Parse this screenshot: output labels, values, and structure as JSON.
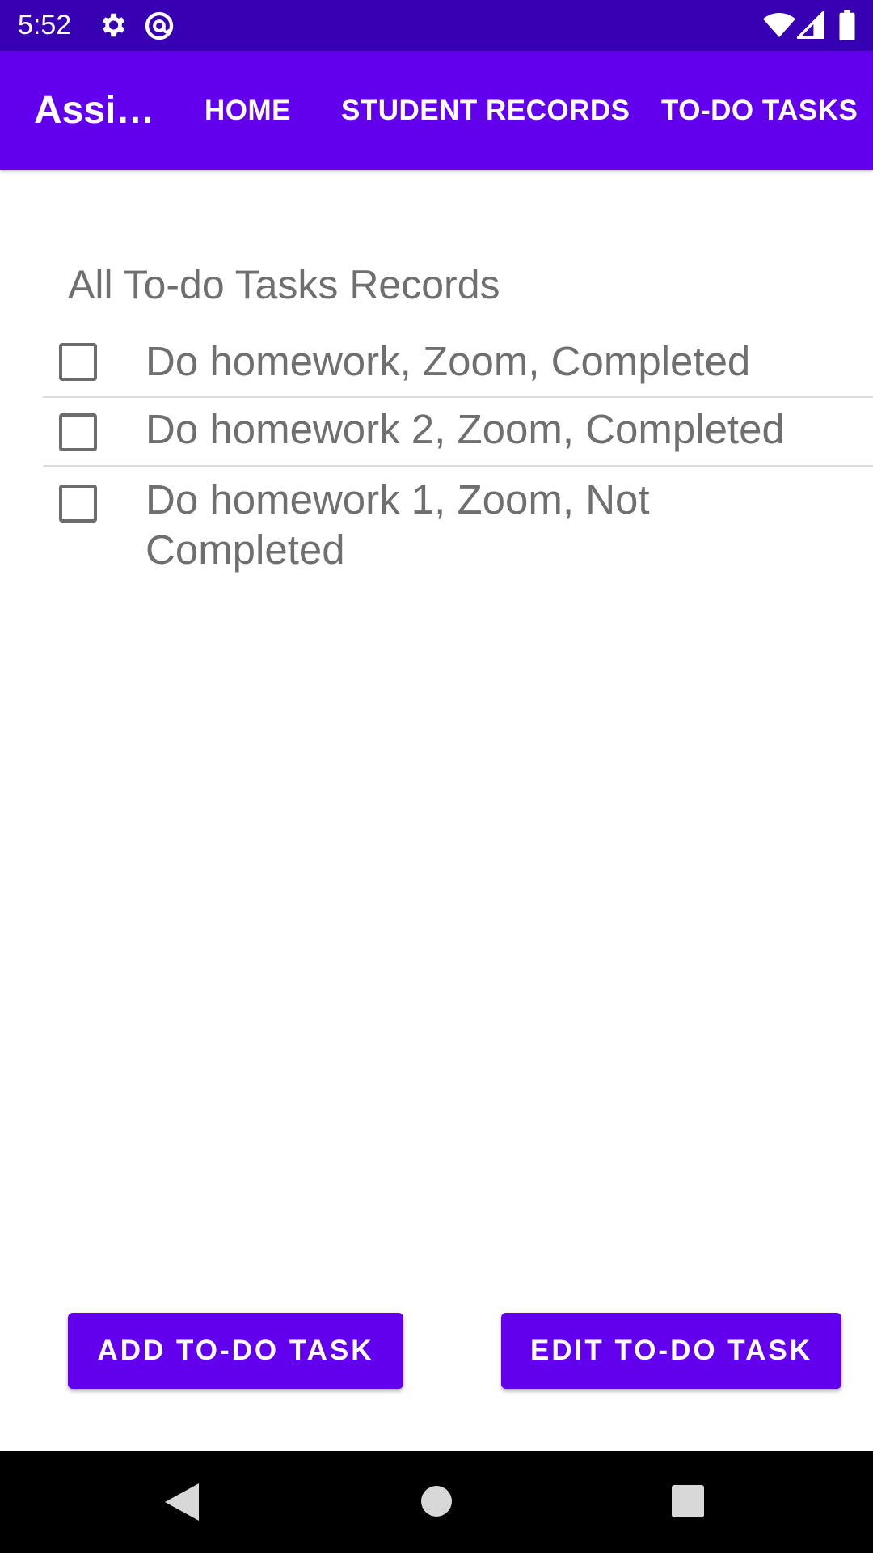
{
  "status_bar": {
    "time": "5:52",
    "icons": [
      "settings-icon",
      "at-sign-icon",
      "wifi-icon",
      "signal-icon",
      "battery-icon"
    ]
  },
  "app_bar": {
    "title": "Assi…",
    "menu": [
      "HOME",
      "STUDENT RECORDS",
      "TO-DO TASKS"
    ]
  },
  "content": {
    "section_title": "All To-do Tasks Records",
    "tasks": [
      {
        "label": "Do homework, Zoom, Completed",
        "checked": false
      },
      {
        "label": "Do homework 2, Zoom, Completed",
        "checked": false
      },
      {
        "label": "Do homework 1, Zoom, Not Completed",
        "checked": false
      }
    ]
  },
  "buttons": {
    "add": "ADD TO-DO TASK",
    "edit": "EDIT TO-DO TASK"
  },
  "colors": {
    "status_bar": "#3700b3",
    "primary": "#6200ee",
    "text_secondary": "#6f6f6f"
  },
  "nav_bar": {
    "icons": [
      "back-icon",
      "home-icon",
      "recents-icon"
    ]
  }
}
